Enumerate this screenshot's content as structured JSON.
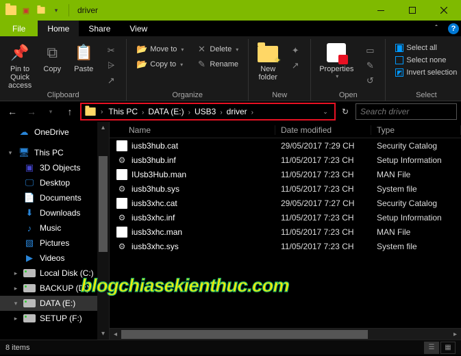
{
  "window": {
    "title": "driver"
  },
  "tabs": {
    "file": "File",
    "home": "Home",
    "share": "Share",
    "view": "View"
  },
  "ribbon": {
    "clipboard": {
      "label": "Clipboard",
      "pin": "Pin to Quick\naccess",
      "copy": "Copy",
      "paste": "Paste"
    },
    "organize": {
      "label": "Organize",
      "move": "Move to",
      "copy": "Copy to",
      "delete": "Delete",
      "rename": "Rename"
    },
    "new": {
      "label": "New",
      "folder": "New\nfolder"
    },
    "open": {
      "label": "Open",
      "properties": "Properties"
    },
    "select": {
      "label": "Select",
      "all": "Select all",
      "none": "Select none",
      "invert": "Invert selection"
    }
  },
  "breadcrumb": [
    "This PC",
    "DATA (E:)",
    "USB3",
    "driver"
  ],
  "search": {
    "placeholder": "Search driver"
  },
  "columns": {
    "name": "Name",
    "date": "Date modified",
    "type": "Type"
  },
  "tree": [
    {
      "label": "OneDrive",
      "icon": "cloud",
      "depth": 0,
      "tw": ""
    },
    {
      "label": "This PC",
      "icon": "pc",
      "depth": 0,
      "tw": "▾"
    },
    {
      "label": "3D Objects",
      "icon": "3d",
      "depth": 1,
      "tw": ""
    },
    {
      "label": "Desktop",
      "icon": "desktop",
      "depth": 1,
      "tw": ""
    },
    {
      "label": "Documents",
      "icon": "docs",
      "depth": 1,
      "tw": ""
    },
    {
      "label": "Downloads",
      "icon": "down",
      "depth": 1,
      "tw": ""
    },
    {
      "label": "Music",
      "icon": "music",
      "depth": 1,
      "tw": ""
    },
    {
      "label": "Pictures",
      "icon": "pics",
      "depth": 1,
      "tw": ""
    },
    {
      "label": "Videos",
      "icon": "video",
      "depth": 1,
      "tw": ""
    },
    {
      "label": "Local Disk (C:)",
      "icon": "drive",
      "depth": 1,
      "tw": "▸"
    },
    {
      "label": "BACKUP (D:)",
      "icon": "drive",
      "depth": 1,
      "tw": "▸"
    },
    {
      "label": "DATA (E:)",
      "icon": "drive",
      "depth": 1,
      "tw": "▾",
      "sel": true
    },
    {
      "label": "SETUP (F:)",
      "icon": "drive",
      "depth": 1,
      "tw": "▸"
    }
  ],
  "files": [
    {
      "name": "iusb3hub.cat",
      "date": "29/05/2017 7:29 CH",
      "type": "Security Catalog",
      "ic": "page"
    },
    {
      "name": "iusb3hub.inf",
      "date": "11/05/2017 7:23 CH",
      "type": "Setup Information",
      "ic": "gear"
    },
    {
      "name": "IUsb3Hub.man",
      "date": "11/05/2017 7:23 CH",
      "type": "MAN File",
      "ic": "page"
    },
    {
      "name": "iusb3hub.sys",
      "date": "11/05/2017 7:23 CH",
      "type": "System file",
      "ic": "gear"
    },
    {
      "name": "iusb3xhc.cat",
      "date": "29/05/2017 7:27 CH",
      "type": "Security Catalog",
      "ic": "page"
    },
    {
      "name": "iusb3xhc.inf",
      "date": "11/05/2017 7:23 CH",
      "type": "Setup Information",
      "ic": "gear"
    },
    {
      "name": "iusb3xhc.man",
      "date": "11/05/2017 7:23 CH",
      "type": "MAN File",
      "ic": "page"
    },
    {
      "name": "iusb3xhc.sys",
      "date": "11/05/2017 7:23 CH",
      "type": "System file",
      "ic": "gear"
    }
  ],
  "status": {
    "count": "8 items"
  },
  "watermark": "blogchiasekienthuc.com"
}
